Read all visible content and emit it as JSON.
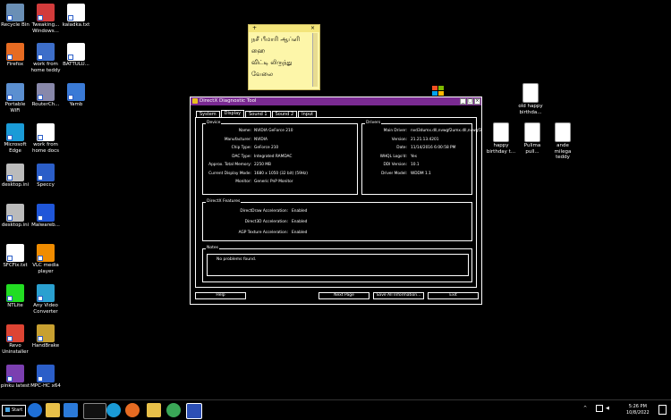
{
  "desktop": {
    "left_icons": [
      {
        "label": "Recycle Bin"
      },
      {
        "label": "Tweaking... Windows..."
      },
      {
        "label": "kaladka.txt"
      },
      {
        "label": "Firefox"
      },
      {
        "label": "work from home teddy"
      },
      {
        "label": "BATTULU..."
      },
      {
        "label": "Portable WiFi"
      },
      {
        "label": "RouterCh..."
      },
      {
        "label": "Yamb"
      },
      {
        "label": "Microsoft Edge"
      },
      {
        "label": "work from home docs"
      },
      {
        "label": "desktop.ini"
      },
      {
        "label": "Speccy"
      },
      {
        "label": "desktop.ini"
      },
      {
        "label": "Malwareb..."
      },
      {
        "label": "SFCFix.txt"
      },
      {
        "label": "VLC media player"
      },
      {
        "label": "NTLite"
      },
      {
        "label": "Any Video Converter"
      },
      {
        "label": "Revo Uninstaller"
      },
      {
        "label": "HandBrake"
      },
      {
        "label": "pinku latest"
      },
      {
        "label": "MPC-HC x64"
      }
    ],
    "right_icons": [
      {
        "label": "old happy birthda..."
      },
      {
        "label": "happy birthday t..."
      },
      {
        "label": "Pulima pull..."
      },
      {
        "label": "ande milega teddy"
      }
    ]
  },
  "sticky_note": {
    "plus": "+",
    "close": "×",
    "lines": [
      "நசீ பீமாரி ஆப்ளி",
      "ஹை",
      "விட்டி லிருந்து",
      "வேலை"
    ]
  },
  "window": {
    "title": "DirectX Diagnostic Tool",
    "tabs": [
      "System",
      "Display",
      "Sound 1",
      "Sound 2",
      "Input"
    ],
    "active_tab": "Display",
    "device": {
      "heading": "Device",
      "rows": [
        {
          "k": "Name:",
          "v": "NVIDIA GeForce 210"
        },
        {
          "k": "Manufacturer:",
          "v": "NVIDIA"
        },
        {
          "k": "Chip Type:",
          "v": "GeForce 210"
        },
        {
          "k": "DAC Type:",
          "v": "Integrated RAMDAC"
        },
        {
          "k": "Approx. Total Memory:",
          "v": "2250 MB"
        },
        {
          "k": "Current Display Mode:",
          "v": "1680 x 1050 (32 bit) (59Hz)"
        },
        {
          "k": "Monitor:",
          "v": "Generic PnP Monitor"
        }
      ]
    },
    "drivers": {
      "heading": "Drivers",
      "rows": [
        {
          "k": "Main Driver:",
          "v": "nvd3dumx.dll,nvwgf2umx.dll,nvwgf2"
        },
        {
          "k": "Version:",
          "v": "21.21.13.4201"
        },
        {
          "k": "Date:",
          "v": "11/14/2016 6:00:58 PM"
        },
        {
          "k": "WHQL Logo'd:",
          "v": "Yes"
        },
        {
          "k": "DDI Version:",
          "v": "10.1"
        },
        {
          "k": "Driver Model:",
          "v": "WDDM 1.1"
        }
      ]
    },
    "features": {
      "heading": "DirectX Features",
      "rows": [
        {
          "k": "DirectDraw Acceleration:",
          "v": "Enabled"
        },
        {
          "k": "Direct3D Acceleration:",
          "v": "Enabled"
        },
        {
          "k": "AGP Texture Acceleration:",
          "v": "Enabled"
        }
      ]
    },
    "notes": {
      "heading": "Notes",
      "text": "No problems found."
    },
    "buttons": {
      "help": "Help",
      "next": "Next Page",
      "save": "Save All Information...",
      "exit": "Exit"
    }
  },
  "taskbar": {
    "start": "Start",
    "time": "5:26 PM",
    "date": "10/8/2022"
  }
}
